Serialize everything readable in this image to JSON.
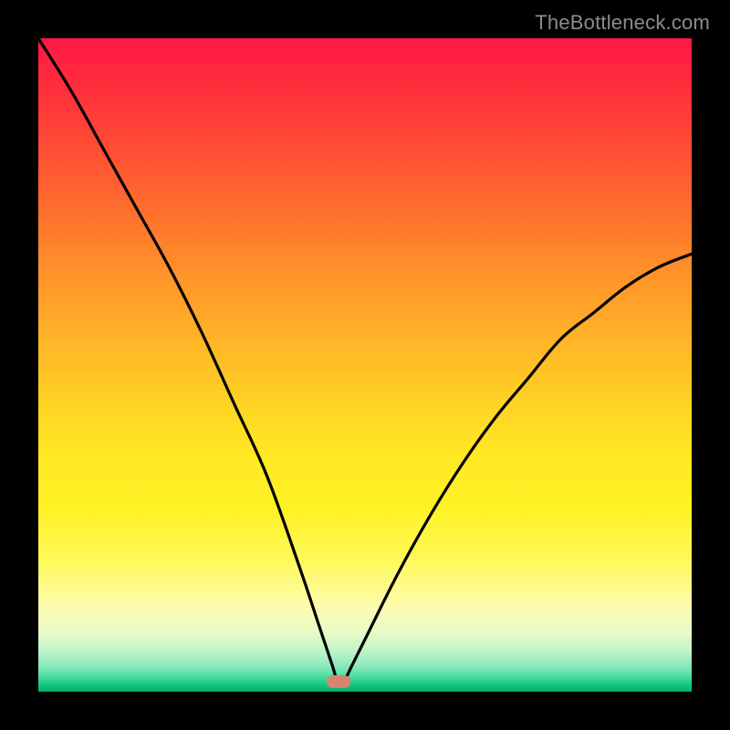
{
  "watermark": "TheBottleneck.com",
  "marker": {
    "x_pct": 46.0,
    "y_pct": 98.5,
    "color": "#d8846f"
  },
  "chart_data": {
    "type": "line",
    "title": "",
    "xlabel": "",
    "ylabel": "",
    "xlim": [
      0,
      100
    ],
    "ylim": [
      0,
      100
    ],
    "series": [
      {
        "name": "bottleneck-curve",
        "x": [
          0,
          5,
          10,
          15,
          20,
          25,
          30,
          35,
          40,
          43,
          45,
          46,
          47,
          48,
          50,
          55,
          60,
          65,
          70,
          75,
          80,
          85,
          90,
          95,
          100
        ],
        "y": [
          100,
          92,
          83,
          74,
          65,
          55,
          44,
          33,
          19,
          10,
          4,
          1,
          2,
          4,
          8,
          18,
          27,
          35,
          42,
          48,
          54,
          58,
          62,
          65,
          67
        ]
      }
    ],
    "annotations": [],
    "grid": false,
    "background_gradient": {
      "direction": "vertical",
      "stops": [
        {
          "pos": 0.0,
          "color": "#ff1744"
        },
        {
          "pos": 0.5,
          "color": "#ffd424"
        },
        {
          "pos": 0.88,
          "color": "#fdfcb0"
        },
        {
          "pos": 1.0,
          "color": "#00b268"
        }
      ]
    }
  }
}
